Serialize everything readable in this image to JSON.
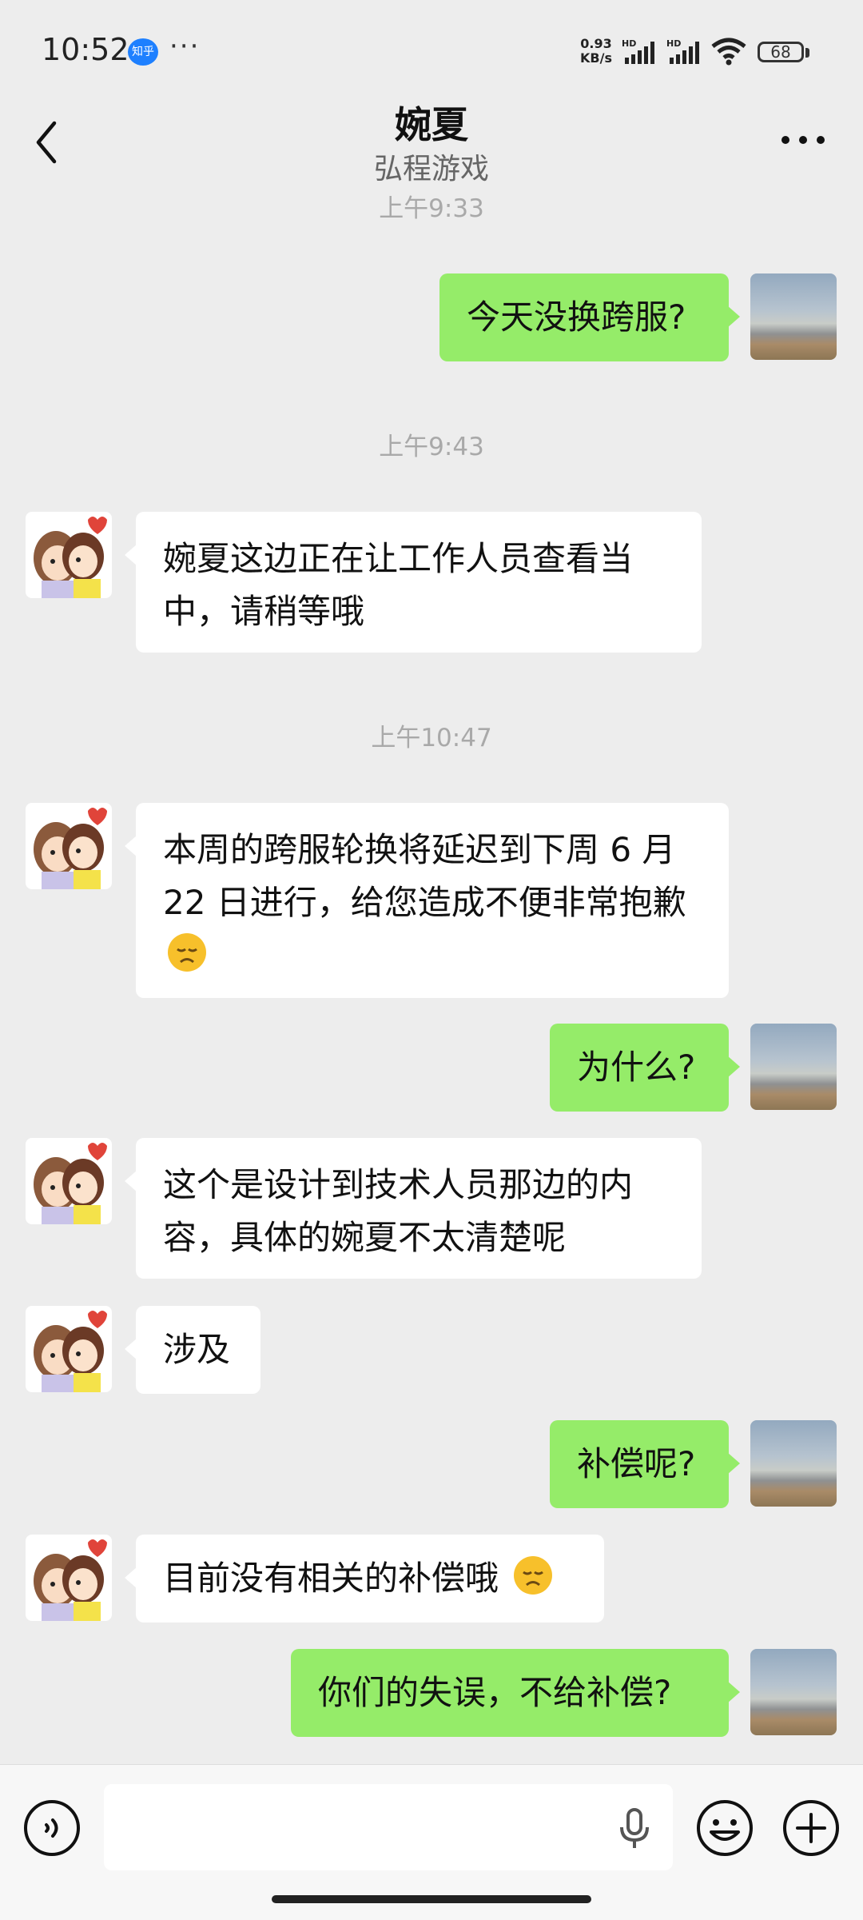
{
  "status_bar": {
    "time": "10:52",
    "app_badge": "知乎",
    "more": "···",
    "net_speed_value": "0.93",
    "net_speed_unit": "KB/s",
    "battery": "68"
  },
  "header": {
    "title": "婉夏",
    "subtitle": "弘程游戏"
  },
  "messages": {
    "ts_0933": "上午9:33",
    "m1": "今天没换跨服?",
    "ts_0943": "上午9:43",
    "m2": "婉夏这边正在让工作人员查看当中，请稍等哦",
    "ts_1047": "上午10:47",
    "m3": "本周的跨服轮换将延迟到下周 6 月 22 日进行，给您造成不便非常抱歉",
    "m4": "为什么?",
    "m5": "这个是设计到技术人员那边的内容，具体的婉夏不太清楚呢",
    "m6": "涉及",
    "m7": "补偿呢?",
    "m8": "目前没有相关的补偿哦",
    "m9": "你们的失误，不给补偿?"
  },
  "input": {
    "placeholder": ""
  },
  "colors": {
    "my_bubble": "#95ec69",
    "other_bubble": "#ffffff",
    "background": "#ededed"
  },
  "icons": [
    "back-icon",
    "more-icon",
    "voice-icon",
    "mic-icon",
    "emoji-icon",
    "plus-icon",
    "wifi-icon",
    "signal-icon"
  ]
}
